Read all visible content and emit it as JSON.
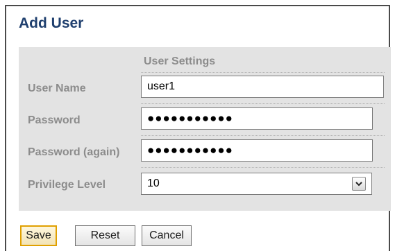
{
  "dialog": {
    "title": "Add User",
    "section_title": "User Settings"
  },
  "form": {
    "username_label": "User Name",
    "username_value": "user1",
    "password_label": "Password",
    "password_value": "●●●●●●●●●●●",
    "password_again_label": "Password (again)",
    "password_again_value": "●●●●●●●●●●●",
    "privilege_label": "Privilege Level",
    "privilege_value": "10",
    "privilege_arrow": "chevron-down-icon"
  },
  "buttons": {
    "save": "Save",
    "reset": "Reset",
    "cancel": "Cancel"
  },
  "colors": {
    "title": "#1f3f6e",
    "panel": "#e3e3e3",
    "label": "#8c8c8c",
    "save_border": "#e0a000"
  }
}
